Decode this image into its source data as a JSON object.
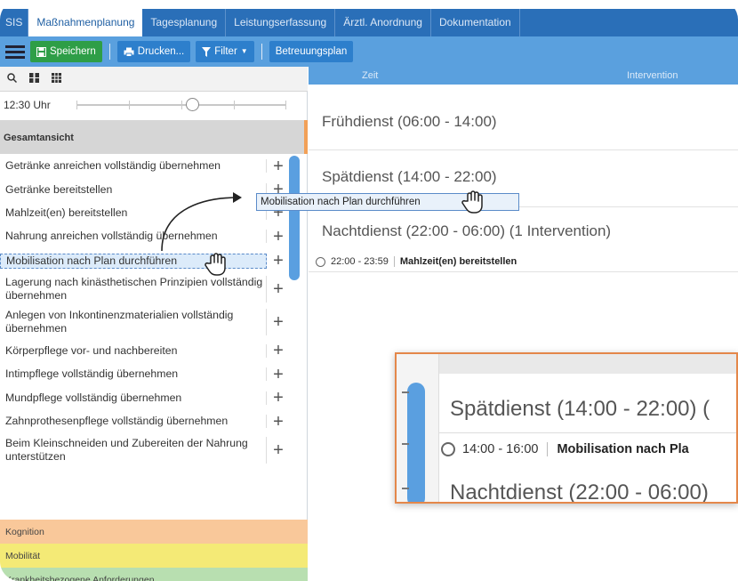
{
  "tabs": [
    {
      "label": "SIS",
      "active": false
    },
    {
      "label": "Maßnahmenplanung",
      "active": true
    },
    {
      "label": "Tagesplanung",
      "active": false
    },
    {
      "label": "Leistungserfassung",
      "active": false
    },
    {
      "label": "Ärztl. Anordnung",
      "active": false
    },
    {
      "label": "Dokumentation",
      "active": false
    }
  ],
  "toolbar": {
    "save_label": "Speichern",
    "print_label": "Drucken...",
    "filter_label": "Filter",
    "care_plan_label": "Betreuungsplan"
  },
  "left_panel": {
    "time_label": "12:30 Uhr",
    "time_fraction": 0.55,
    "group_heading": "Gesamtansicht",
    "items": [
      "Getränke anreichen vollständig übernehmen",
      "Getränke bereitstellen",
      "Mahlzeit(en) bereitstellen",
      "Nahrung anreichen vollständig übernehmen",
      "Mobilisation nach Plan durchführen",
      "Lagerung nach kinästhetischen Prinzipien vollständig übernehmen",
      "Anlegen von Inkontinenzmaterialien vollständig übernehmen",
      "Körperpflege vor- und nachbereiten",
      "Intimpflege vollständig übernehmen",
      "Mundpflege vollständig übernehmen",
      "Zahnprothesenpflege vollständig übernehmen",
      "Beim Kleinschneiden und Zubereiten der Nahrung unterstützen"
    ],
    "highlighted_index": 4,
    "categories": [
      {
        "label": "Kognition",
        "color": "#f9c89a"
      },
      {
        "label": "Mobilität",
        "color": "#f4ea76"
      },
      {
        "label": "Krankheitsbezogene Anforderungen",
        "color": "#b8dfb0"
      }
    ]
  },
  "schedule": {
    "header_time": "Zeit",
    "header_intervention": "Intervention",
    "shifts": [
      "Frühdienst (06:00 - 14:00)",
      "Spätdienst (14:00 - 22:00)",
      "Nachtdienst (22:00 - 06:00) (1 Intervention)"
    ],
    "entry_time": "22:00 - 23:59",
    "entry_name": "Mahlzeit(en) bereitstellen"
  },
  "drag_tooltip": "Mobilisation nach Plan durchführen",
  "inset": {
    "shift": "Spätdienst (14:00 - 22:00) (",
    "entry_time": "14:00 - 16:00",
    "entry_name": "Mobilisation nach Pla",
    "next_shift": "Nachtdienst (22:00 - 06:00)"
  },
  "colors": {
    "tab_bar": "#2a6fb8",
    "toolbar": "#5aa0de",
    "save_button": "#2e9e47",
    "accent_orange": "#e4874a"
  },
  "icons": [
    "menu-icon",
    "save-icon",
    "print-icon",
    "filter-icon",
    "search-icon",
    "columns-icon",
    "grid-icon",
    "plus-icon",
    "hand-cursor-icon",
    "arrow-icon"
  ]
}
